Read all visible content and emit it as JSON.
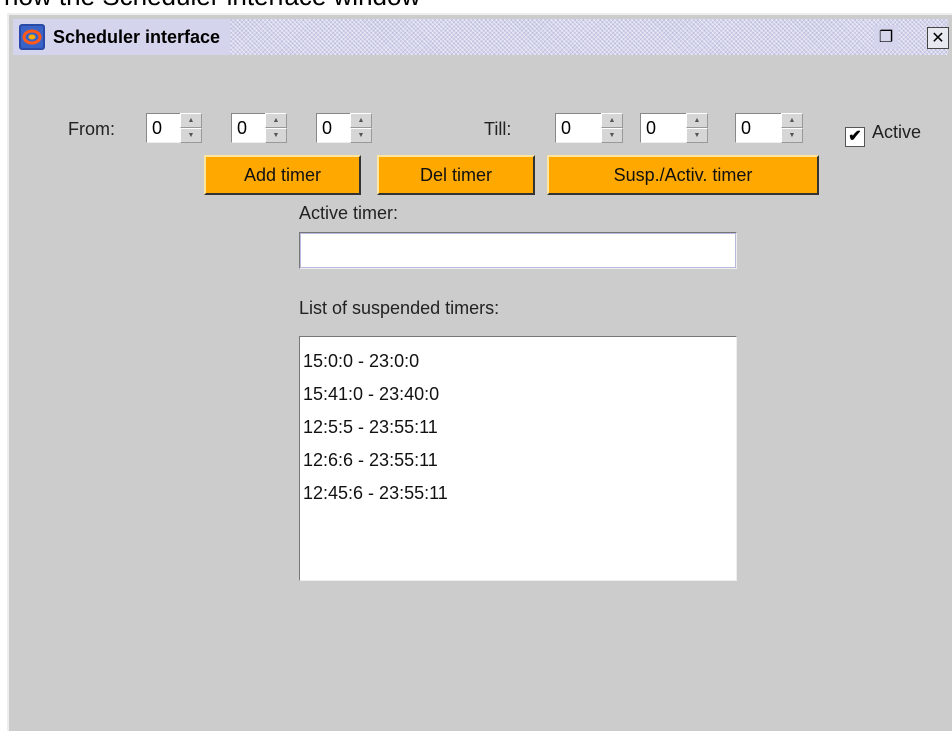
{
  "window": {
    "caption_behind": "now the Scheduler interface window",
    "title": "Scheduler interface",
    "restore_glyph": "❐",
    "close_glyph": "✕"
  },
  "from": {
    "label": "From:",
    "hours": "0",
    "minutes": "0",
    "seconds": "0"
  },
  "till": {
    "label": "Till:",
    "hours": "0",
    "minutes": "0",
    "seconds": "0"
  },
  "active_checkbox": {
    "label": "Active",
    "checked": true,
    "glyph": "✔"
  },
  "buttons": {
    "add": "Add timer",
    "del": "Del timer",
    "susp": "Susp./Activ. timer"
  },
  "active_timer": {
    "label": "Active timer:",
    "value": ""
  },
  "suspended": {
    "label": "List of suspended timers:",
    "items": [
      "15:0:0 - 23:0:0",
      "15:41:0 - 23:40:0",
      "12:5:5 - 23:55:11",
      "12:6:6 - 23:55:11",
      "12:45:6 - 23:55:11"
    ]
  },
  "colors": {
    "button_accent": "#ffa800",
    "window_bg": "#cccccc",
    "titlebar_bg": "#d4d4ec"
  },
  "icons": {
    "app": "scheduler-app-icon",
    "restore": "restore-icon",
    "close": "close-icon",
    "spin_up": "arrow-up-icon",
    "spin_down": "arrow-down-icon",
    "check": "checkmark-icon"
  }
}
